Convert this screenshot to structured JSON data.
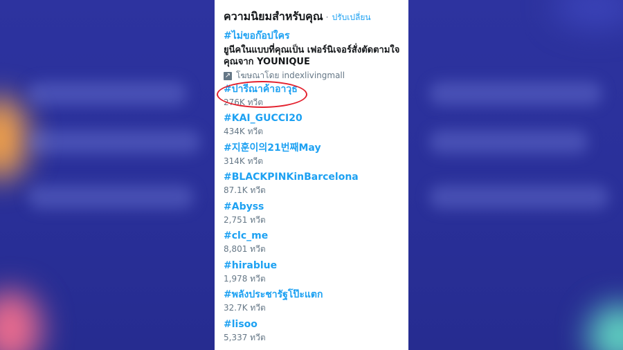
{
  "panel": {
    "title": "ความนิยมสำหรับคุณ",
    "separator": "·",
    "change_label": "ปรับเปลี่ยน"
  },
  "promoted": {
    "tag": "#ไม่ขอก๊อปใคร",
    "description": "ยูนีคในแบบที่คุณเป็น เฟอร์นิเจอร์สั่งตัดตามใจคุณจาก YOUNIQUE",
    "promoted_by": "โฆษณาโดย indexlivingmall",
    "icon": "promoted-arrow-icon"
  },
  "trends": [
    {
      "tag": "#ปารีณาค้าอาวุธ",
      "count": "276K ทวีต",
      "highlighted": true
    },
    {
      "tag": "#KAI_GUCCI20",
      "count": "434K ทวีต"
    },
    {
      "tag": "#지훈이의21번째May",
      "count": "314K ทวีต"
    },
    {
      "tag": "#BLACKPINKinBarcelona",
      "count": "87.1K ทวีต"
    },
    {
      "tag": "#Abyss",
      "count": "2,751 ทวีต"
    },
    {
      "tag": "#clc_me",
      "count": "8,801 ทวีต"
    },
    {
      "tag": "#hirablue",
      "count": "1,978 ทวีต"
    },
    {
      "tag": "#พลังประชารัฐโป๊ะแตก",
      "count": "32.7K ทวีต"
    },
    {
      "tag": "#lisoo",
      "count": "5,337 ทวีต"
    }
  ],
  "colors": {
    "link": "#1da1f2",
    "text": "#14171a",
    "muted": "#657786",
    "highlight": "#e3202d",
    "background": "#2a2f9a"
  }
}
